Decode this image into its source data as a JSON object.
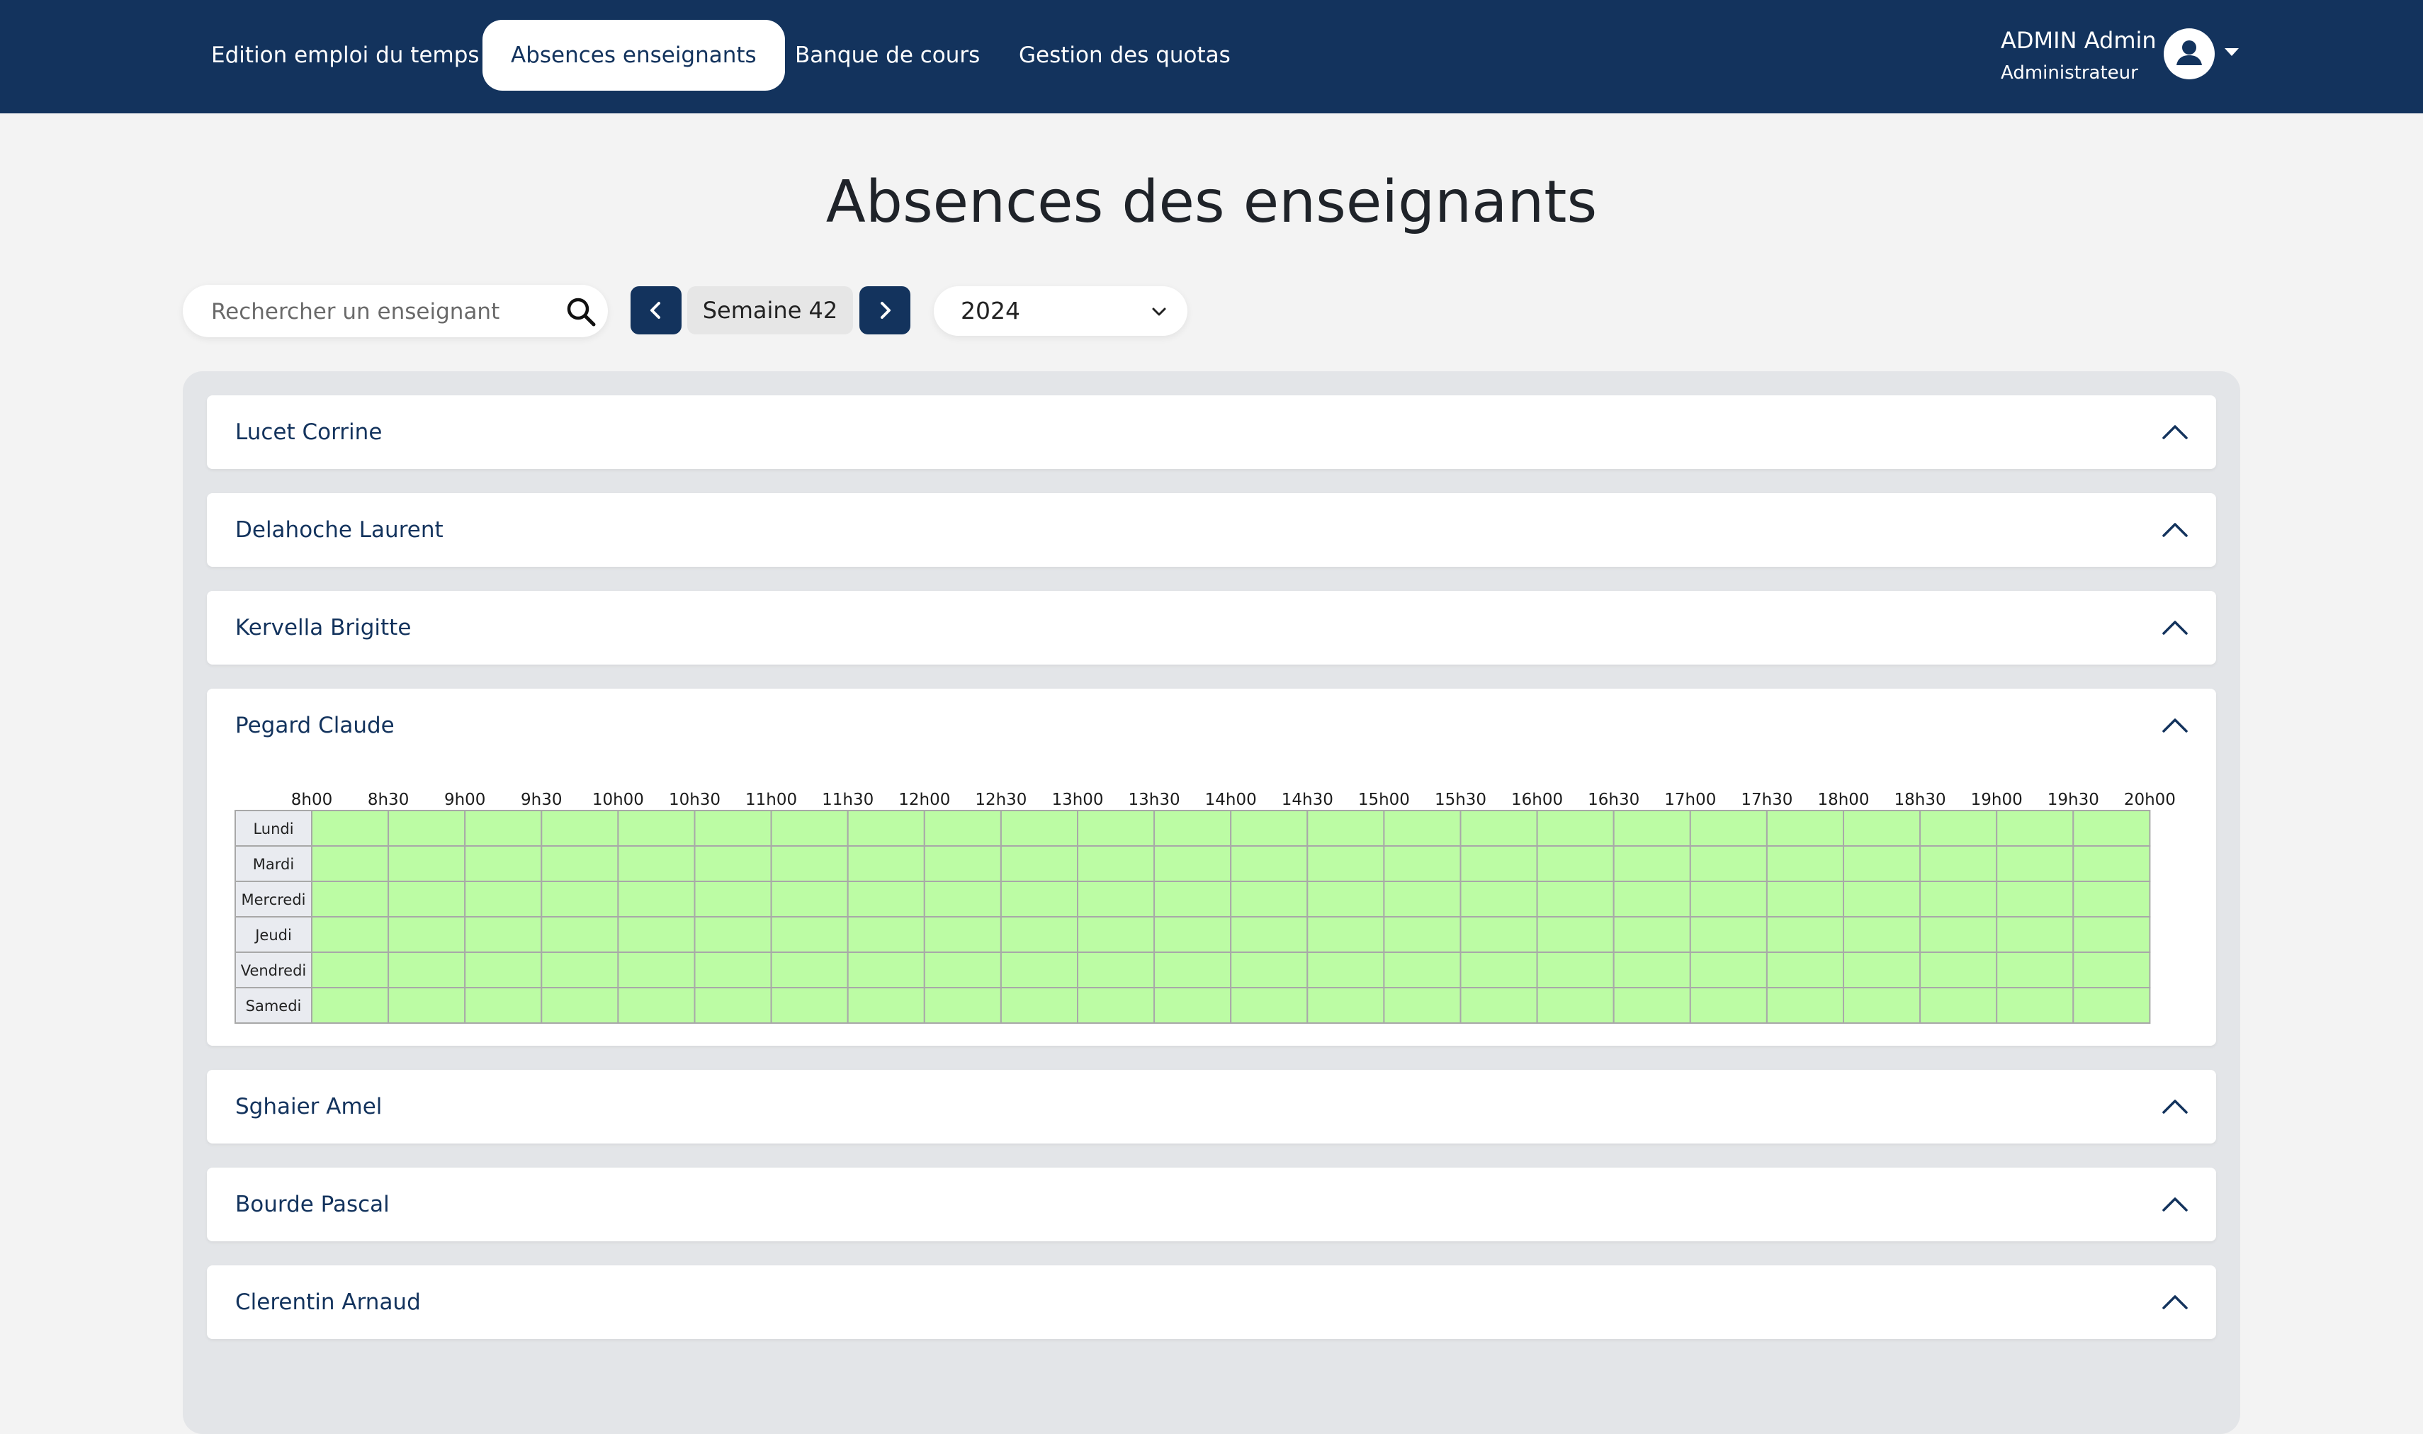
{
  "nav": {
    "items": [
      {
        "label": "Edition emploi du temps"
      },
      {
        "label": "Absences enseignants"
      },
      {
        "label": "Banque de cours"
      },
      {
        "label": "Gestion des quotas"
      }
    ],
    "active_index": 1
  },
  "user": {
    "name": "ADMIN Admin",
    "role": "Administrateur"
  },
  "page": {
    "title": "Absences des enseignants"
  },
  "toolbar": {
    "search_placeholder": "Rechercher un enseignant",
    "week_label": "Semaine 42",
    "year": "2024"
  },
  "teachers": [
    {
      "name": "Lucet Corrine",
      "expanded": false
    },
    {
      "name": "Delahoche Laurent",
      "expanded": false
    },
    {
      "name": "Kervella Brigitte",
      "expanded": false
    },
    {
      "name": "Pegard Claude",
      "expanded": true
    },
    {
      "name": "Sghaier Amel",
      "expanded": false
    },
    {
      "name": "Bourde Pascal",
      "expanded": false
    },
    {
      "name": "Clerentin Arnaud",
      "expanded": false
    }
  ],
  "schedule": {
    "times": [
      "8h00",
      "8h30",
      "9h00",
      "9h30",
      "10h00",
      "10h30",
      "11h00",
      "11h30",
      "12h00",
      "12h30",
      "13h00",
      "13h30",
      "14h00",
      "14h30",
      "15h00",
      "15h30",
      "16h00",
      "16h30",
      "17h00",
      "17h30",
      "18h00",
      "18h30",
      "19h00",
      "19h30",
      "20h00"
    ],
    "days": [
      "Lundi",
      "Mardi",
      "Mercredi",
      "Jeudi",
      "Vendredi",
      "Samedi"
    ],
    "available_color": "#bcfca4",
    "day_header_color": "#e9ebf0",
    "grid_line_color": "#a8a8a8"
  },
  "colors": {
    "navbar": "#13335d",
    "accent": "#13335d",
    "background": "#f3f3f3"
  }
}
